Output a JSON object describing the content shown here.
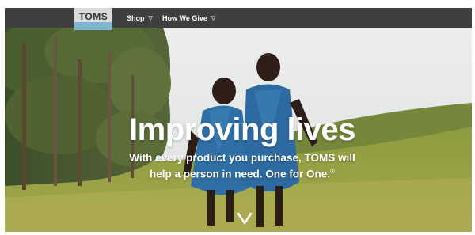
{
  "header": {
    "logo_text": "TOMS",
    "nav": [
      {
        "label": "Shop",
        "icon": "chevron-down-icon"
      },
      {
        "label": "How We Give",
        "icon": "chevron-down-icon"
      }
    ]
  },
  "hero": {
    "title": "Improving lives",
    "subtitle_line1": "With every product you purchase, TOMS will",
    "subtitle_line2": "help a person in need. One for One.",
    "registered_mark": "®",
    "scroll_icon": "chevron-down-icon"
  },
  "colors": {
    "navbar": "#3f3f3f",
    "logo_band": "#7eb7cf",
    "sky": "#e8e9ea",
    "grass": "#8a9a3c",
    "uniform": "#2f6fa6"
  }
}
